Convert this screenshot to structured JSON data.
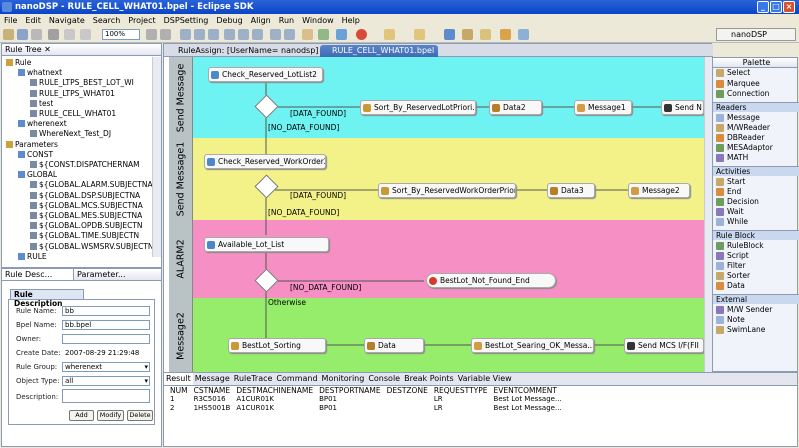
{
  "window": {
    "title": "nanoDSP - RULE_CELL_WHAT01.bpel - Eclipse SDK"
  },
  "menu": [
    "File",
    "Edit",
    "Navigate",
    "Search",
    "Project",
    "DSPSetting",
    "Debug",
    "Align",
    "Run",
    "Window",
    "Help"
  ],
  "toolbar": {
    "zoom": "100%",
    "perspective": "nanoDSP"
  },
  "ruletree": {
    "tab": "Rule Tree",
    "items": [
      {
        "label": "Rule",
        "level": 0
      },
      {
        "label": "whatnext",
        "level": 1
      },
      {
        "label": "RULE_LTPS_BEST_LOT_WI",
        "level": 2
      },
      {
        "label": "RULE_LTPS_WHAT01",
        "level": 2
      },
      {
        "label": "test",
        "level": 2
      },
      {
        "label": "RULE_CELL_WHAT01",
        "level": 2
      },
      {
        "label": "wherenext",
        "level": 1
      },
      {
        "label": "WhereNext_Test_DJ",
        "level": 2
      },
      {
        "label": "Parameters",
        "level": 0
      },
      {
        "label": "CONST",
        "level": 1
      },
      {
        "label": "${CONST.DISPATCHERNAM",
        "level": 2
      },
      {
        "label": "GLOBAL",
        "level": 1
      },
      {
        "label": "${GLOBAL.ALARM.SUBJECTNA",
        "level": 2
      },
      {
        "label": "${GLOBAL.DSP.SUBJECTNA",
        "level": 2
      },
      {
        "label": "${GLOBAL.MCS.SUBJECTNA",
        "level": 2
      },
      {
        "label": "${GLOBAL.MES.SUBJECTNA",
        "level": 2
      },
      {
        "label": "${GLOBAL.OPDB.SUBJECTN",
        "level": 2
      },
      {
        "label": "${GLOBAL.TIME.SUBJECTN",
        "level": 2
      },
      {
        "label": "${GLOBAL.WSMSRV.SUBJECTN",
        "level": 2
      },
      {
        "label": "RULE",
        "level": 1
      }
    ]
  },
  "ruledesc": {
    "tabs": [
      "Rule Desc...",
      "Parameter..."
    ],
    "title": "Rule Description",
    "labels": {
      "name": "Rule Name:",
      "bpel": "Bpel Name:",
      "owner": "Owner:",
      "date": "Create Date:",
      "group": "Rule Group:",
      "otype": "Object Type:",
      "desc": "Description:"
    },
    "values": {
      "name": "bb",
      "bpel": "bb.bpel",
      "owner": "",
      "date": "2007-08-29 21:29:48",
      "group": "wherenext",
      "otype": "all",
      "desc": ""
    },
    "buttons": {
      "add": "Add",
      "modify": "Modify",
      "delete": "Delete"
    }
  },
  "editor": {
    "tabs": [
      "RuleAssign: [UserName= nanodsp]",
      "RULE_CELL_WHAT01.bpel"
    ],
    "lanes": [
      {
        "label": "Send Message",
        "color": "#6ef2f2"
      },
      {
        "label": "Send Message1",
        "color": "#f2f289"
      },
      {
        "label": "ALARM2",
        "color": "#f58fc4"
      },
      {
        "label": "Message2",
        "color": "#95ed6b"
      }
    ],
    "nodes": {
      "n1": "Check_Reserved_LotList2",
      "n2": "Sort_By_ReservedLotPriori...",
      "n3": "Data2",
      "n4": "Message1",
      "n5": "Send N",
      "n6": "Check_Reserved_WorkOrder2",
      "n7": "Sort_By_ReservedWorkOrderPriori...",
      "n8": "Data3",
      "n9": "Message2",
      "n10": "Available_Lot_List",
      "n11": "BestLot_Not_Found_End",
      "n12": "BestLot_Sorting",
      "n13": "Data",
      "n14": "BestLot_Searing_OK_Messa...",
      "n15": "Send MCS I/F(FII"
    },
    "edges": {
      "e1": "[DATA_FOUND]",
      "e2": "[NO_DATA_FOUND]",
      "e3": "[DATA_FOUND]",
      "e4": "[NO_DATA_FOUND]",
      "e5": "[NO_DATA_FOUND]",
      "e6": "Otherwise"
    }
  },
  "palette": {
    "title": "Palette",
    "top": [
      "Select",
      "Marquee",
      "Connection"
    ],
    "sections": [
      {
        "name": "Readers",
        "items": [
          "Message",
          "M/WReader",
          "DBReader",
          "MESAdaptor",
          "MATH"
        ]
      },
      {
        "name": "Activities",
        "items": [
          "Start",
          "End",
          "Decision",
          "Wait",
          "While"
        ]
      },
      {
        "name": "Rule Block",
        "items": [
          "RuleBlock",
          "Script",
          "Filter",
          "Sorter",
          "Data"
        ]
      },
      {
        "name": "External",
        "items": [
          "M/W Sender",
          "Note",
          "SwimLane"
        ]
      }
    ]
  },
  "result": {
    "tabs": [
      "Result",
      "Message",
      "RuleTrace",
      "Command",
      "Monitoring",
      "Console",
      "Break Points",
      "Variable View"
    ],
    "columns": [
      "NUM",
      "CSTNAME",
      "DESTMACHINENAME",
      "DESTPORTNAME",
      "DESTZONE",
      "REQUESTTYPE",
      "EVENTCOMMENT"
    ],
    "rows": [
      [
        "1",
        "R3C5016",
        "A1CUR01K",
        "BP01",
        "",
        "LR",
        "Best Lot Message..."
      ],
      [
        "2",
        "1HS5001B",
        "A1CUR01K",
        "BP01",
        "",
        "LR",
        "Best Lot Message..."
      ]
    ]
  },
  "colors": {
    "titlebar": "#0a45c6",
    "laneLabel": "#b9c2c5",
    "paletteSection": "#c9d7ef"
  }
}
